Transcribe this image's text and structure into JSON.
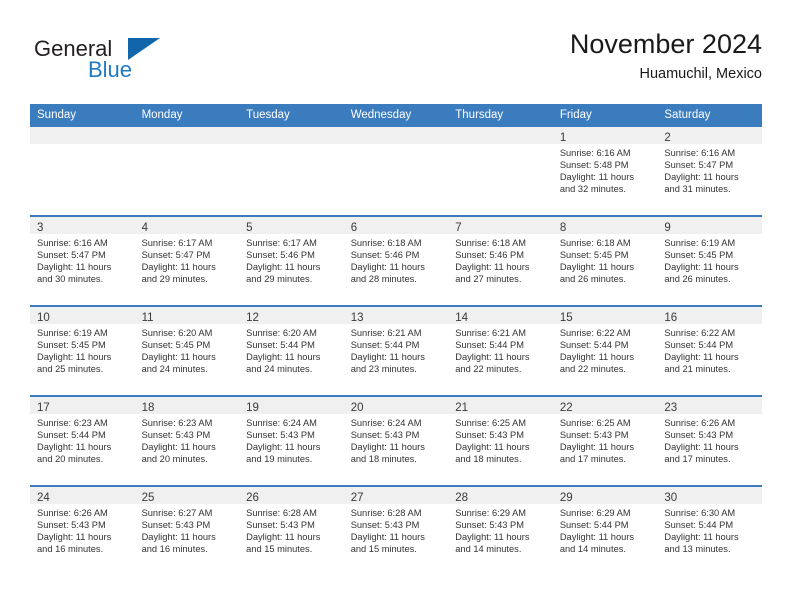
{
  "brand": {
    "name_top": "General",
    "name_bottom": "Blue",
    "accent_color": "#1166ab",
    "text_color": "#231f20"
  },
  "header": {
    "title": "November 2024",
    "location": "Huamuchil, Mexico"
  },
  "theme": {
    "header_bg": "#3b7cbf",
    "header_text": "#ffffff",
    "daynum_strip_bg": "#f0f0f0",
    "cell_border": "#3b7cbf"
  },
  "weekdays": [
    "Sunday",
    "Monday",
    "Tuesday",
    "Wednesday",
    "Thursday",
    "Friday",
    "Saturday"
  ],
  "labels": {
    "sunrise": "Sunrise:",
    "sunset": "Sunset:",
    "daylight": "Daylight:"
  },
  "weeks": [
    [
      {
        "empty": true
      },
      {
        "empty": true
      },
      {
        "empty": true
      },
      {
        "empty": true
      },
      {
        "empty": true
      },
      {
        "day": "1",
        "sunrise": "Sunrise: 6:16 AM",
        "sunset": "Sunset: 5:48 PM",
        "daylight_1": "Daylight: 11 hours",
        "daylight_2": "and 32 minutes."
      },
      {
        "day": "2",
        "sunrise": "Sunrise: 6:16 AM",
        "sunset": "Sunset: 5:47 PM",
        "daylight_1": "Daylight: 11 hours",
        "daylight_2": "and 31 minutes."
      }
    ],
    [
      {
        "day": "3",
        "sunrise": "Sunrise: 6:16 AM",
        "sunset": "Sunset: 5:47 PM",
        "daylight_1": "Daylight: 11 hours",
        "daylight_2": "and 30 minutes."
      },
      {
        "day": "4",
        "sunrise": "Sunrise: 6:17 AM",
        "sunset": "Sunset: 5:47 PM",
        "daylight_1": "Daylight: 11 hours",
        "daylight_2": "and 29 minutes."
      },
      {
        "day": "5",
        "sunrise": "Sunrise: 6:17 AM",
        "sunset": "Sunset: 5:46 PM",
        "daylight_1": "Daylight: 11 hours",
        "daylight_2": "and 29 minutes."
      },
      {
        "day": "6",
        "sunrise": "Sunrise: 6:18 AM",
        "sunset": "Sunset: 5:46 PM",
        "daylight_1": "Daylight: 11 hours",
        "daylight_2": "and 28 minutes."
      },
      {
        "day": "7",
        "sunrise": "Sunrise: 6:18 AM",
        "sunset": "Sunset: 5:46 PM",
        "daylight_1": "Daylight: 11 hours",
        "daylight_2": "and 27 minutes."
      },
      {
        "day": "8",
        "sunrise": "Sunrise: 6:18 AM",
        "sunset": "Sunset: 5:45 PM",
        "daylight_1": "Daylight: 11 hours",
        "daylight_2": "and 26 minutes."
      },
      {
        "day": "9",
        "sunrise": "Sunrise: 6:19 AM",
        "sunset": "Sunset: 5:45 PM",
        "daylight_1": "Daylight: 11 hours",
        "daylight_2": "and 26 minutes."
      }
    ],
    [
      {
        "day": "10",
        "sunrise": "Sunrise: 6:19 AM",
        "sunset": "Sunset: 5:45 PM",
        "daylight_1": "Daylight: 11 hours",
        "daylight_2": "and 25 minutes."
      },
      {
        "day": "11",
        "sunrise": "Sunrise: 6:20 AM",
        "sunset": "Sunset: 5:45 PM",
        "daylight_1": "Daylight: 11 hours",
        "daylight_2": "and 24 minutes."
      },
      {
        "day": "12",
        "sunrise": "Sunrise: 6:20 AM",
        "sunset": "Sunset: 5:44 PM",
        "daylight_1": "Daylight: 11 hours",
        "daylight_2": "and 24 minutes."
      },
      {
        "day": "13",
        "sunrise": "Sunrise: 6:21 AM",
        "sunset": "Sunset: 5:44 PM",
        "daylight_1": "Daylight: 11 hours",
        "daylight_2": "and 23 minutes."
      },
      {
        "day": "14",
        "sunrise": "Sunrise: 6:21 AM",
        "sunset": "Sunset: 5:44 PM",
        "daylight_1": "Daylight: 11 hours",
        "daylight_2": "and 22 minutes."
      },
      {
        "day": "15",
        "sunrise": "Sunrise: 6:22 AM",
        "sunset": "Sunset: 5:44 PM",
        "daylight_1": "Daylight: 11 hours",
        "daylight_2": "and 22 minutes."
      },
      {
        "day": "16",
        "sunrise": "Sunrise: 6:22 AM",
        "sunset": "Sunset: 5:44 PM",
        "daylight_1": "Daylight: 11 hours",
        "daylight_2": "and 21 minutes."
      }
    ],
    [
      {
        "day": "17",
        "sunrise": "Sunrise: 6:23 AM",
        "sunset": "Sunset: 5:44 PM",
        "daylight_1": "Daylight: 11 hours",
        "daylight_2": "and 20 minutes."
      },
      {
        "day": "18",
        "sunrise": "Sunrise: 6:23 AM",
        "sunset": "Sunset: 5:43 PM",
        "daylight_1": "Daylight: 11 hours",
        "daylight_2": "and 20 minutes."
      },
      {
        "day": "19",
        "sunrise": "Sunrise: 6:24 AM",
        "sunset": "Sunset: 5:43 PM",
        "daylight_1": "Daylight: 11 hours",
        "daylight_2": "and 19 minutes."
      },
      {
        "day": "20",
        "sunrise": "Sunrise: 6:24 AM",
        "sunset": "Sunset: 5:43 PM",
        "daylight_1": "Daylight: 11 hours",
        "daylight_2": "and 18 minutes."
      },
      {
        "day": "21",
        "sunrise": "Sunrise: 6:25 AM",
        "sunset": "Sunset: 5:43 PM",
        "daylight_1": "Daylight: 11 hours",
        "daylight_2": "and 18 minutes."
      },
      {
        "day": "22",
        "sunrise": "Sunrise: 6:25 AM",
        "sunset": "Sunset: 5:43 PM",
        "daylight_1": "Daylight: 11 hours",
        "daylight_2": "and 17 minutes."
      },
      {
        "day": "23",
        "sunrise": "Sunrise: 6:26 AM",
        "sunset": "Sunset: 5:43 PM",
        "daylight_1": "Daylight: 11 hours",
        "daylight_2": "and 17 minutes."
      }
    ],
    [
      {
        "day": "24",
        "sunrise": "Sunrise: 6:26 AM",
        "sunset": "Sunset: 5:43 PM",
        "daylight_1": "Daylight: 11 hours",
        "daylight_2": "and 16 minutes."
      },
      {
        "day": "25",
        "sunrise": "Sunrise: 6:27 AM",
        "sunset": "Sunset: 5:43 PM",
        "daylight_1": "Daylight: 11 hours",
        "daylight_2": "and 16 minutes."
      },
      {
        "day": "26",
        "sunrise": "Sunrise: 6:28 AM",
        "sunset": "Sunset: 5:43 PM",
        "daylight_1": "Daylight: 11 hours",
        "daylight_2": "and 15 minutes."
      },
      {
        "day": "27",
        "sunrise": "Sunrise: 6:28 AM",
        "sunset": "Sunset: 5:43 PM",
        "daylight_1": "Daylight: 11 hours",
        "daylight_2": "and 15 minutes."
      },
      {
        "day": "28",
        "sunrise": "Sunrise: 6:29 AM",
        "sunset": "Sunset: 5:43 PM",
        "daylight_1": "Daylight: 11 hours",
        "daylight_2": "and 14 minutes."
      },
      {
        "day": "29",
        "sunrise": "Sunrise: 6:29 AM",
        "sunset": "Sunset: 5:44 PM",
        "daylight_1": "Daylight: 11 hours",
        "daylight_2": "and 14 minutes."
      },
      {
        "day": "30",
        "sunrise": "Sunrise: 6:30 AM",
        "sunset": "Sunset: 5:44 PM",
        "daylight_1": "Daylight: 11 hours",
        "daylight_2": "and 13 minutes."
      }
    ]
  ]
}
